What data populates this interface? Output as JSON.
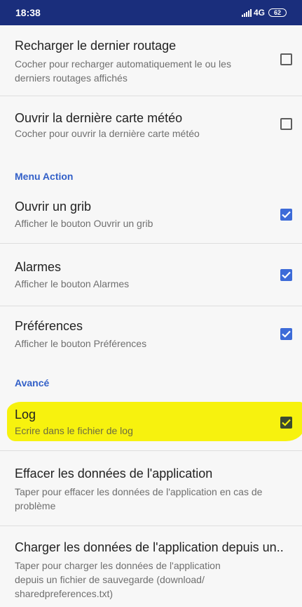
{
  "status_bar": {
    "time": "18:38",
    "network": "4G",
    "battery": "62"
  },
  "preferences": [
    {
      "title": "Recharger le dernier routage",
      "summary": "Cocher pour recharger automatiquement le ou les derniers routages affichés",
      "checked": false
    },
    {
      "title": "Ouvrir la dernière carte météo",
      "summary": "Cocher pour ouvrir la dernière carte météo",
      "checked": false
    }
  ],
  "section_menu_action": {
    "header": "Menu Action",
    "items": [
      {
        "title": "Ouvrir un grib",
        "summary": "Afficher le bouton Ouvrir un grib",
        "checked": true
      },
      {
        "title": "Alarmes",
        "summary": "Afficher le bouton Alarmes",
        "checked": true
      },
      {
        "title": "Préférences",
        "summary": "Afficher le bouton Préférences",
        "checked": true
      }
    ]
  },
  "section_avance": {
    "header": "Avancé",
    "items": [
      {
        "title": "Log",
        "summary": "Ecrire dans le fichier de log",
        "checked": true,
        "highlighted": true
      },
      {
        "title": "Effacer les données de l'application",
        "summary": "Taper pour effacer les données de l'application en cas de problème"
      },
      {
        "title": "Charger les données de l'application depuis un..",
        "summary": "Taper pour charger les données de l'application depuis un fichier de sauvegarde (download/ sharedpreferences.txt)"
      }
    ]
  },
  "colors": {
    "status_bar": "#1a2e7c",
    "accent": "#3d6bd8",
    "section_header": "#3360c8",
    "highlight": "#f7f20e"
  }
}
